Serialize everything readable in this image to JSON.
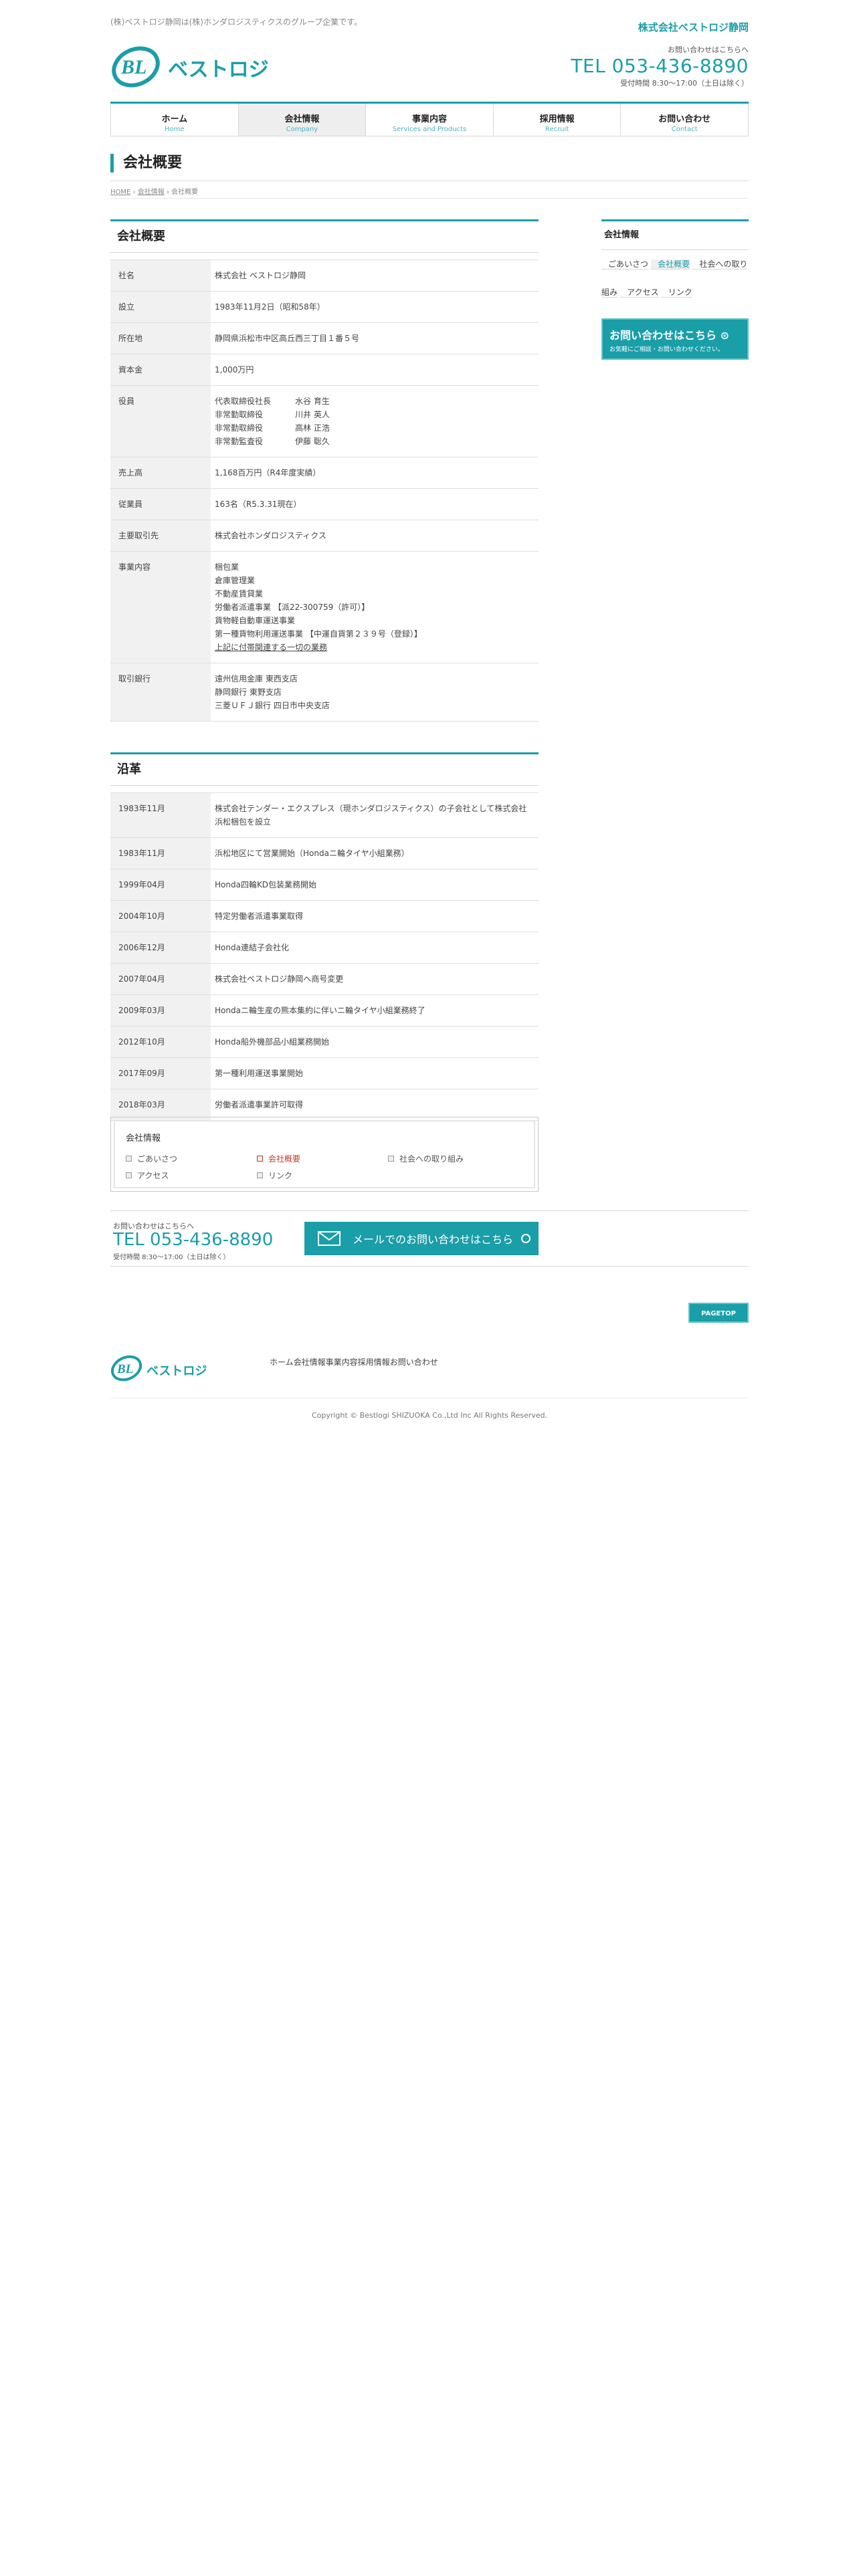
{
  "header": {
    "tagline": "(株)ベストロジ静岡は(株)ホンダロジスティクスのグループ企業です。",
    "corp_name": "株式会社ベストロジ静岡",
    "logo_text": "ベストロジ",
    "contact_label": "お問い合わせはこちらへ",
    "tel": "TEL 053-436-8890",
    "hours": "受付時間 8:30〜17:00（土日は除く）"
  },
  "gnav": [
    {
      "ja": "ホーム",
      "en": "Home"
    },
    {
      "ja": "会社情報",
      "en": "Company"
    },
    {
      "ja": "事業内容",
      "en": "Services and Products"
    },
    {
      "ja": "採用情報",
      "en": "Recruit"
    },
    {
      "ja": "お問い合わせ",
      "en": "Contact"
    }
  ],
  "page_title": "会社概要",
  "breadcrumb": {
    "home": "HOME",
    "company": "会社情報",
    "current": "会社概要",
    "sep": "›"
  },
  "overview": {
    "heading": "会社概要",
    "rows": [
      {
        "th": "社名",
        "td": [
          "株式会社 ベストロジ静岡"
        ]
      },
      {
        "th": "設立",
        "td": [
          "1983年11月2日（昭和58年）"
        ]
      },
      {
        "th": "所在地",
        "td": [
          "静岡県浜松市中区高丘西三丁目１番５号"
        ]
      },
      {
        "th": "資本金",
        "td": [
          "1,000万円"
        ]
      },
      {
        "th": "売上高",
        "td": [
          "1,168百万円（R4年度実績）"
        ]
      },
      {
        "th": "従業員",
        "td": [
          "163名（R5.3.31現在）"
        ]
      },
      {
        "th": "主要取引先",
        "td": [
          "株式会社ホンダロジスティクス"
        ]
      },
      {
        "th": "事業内容",
        "td": [
          "梱包業",
          "倉庫管理業",
          "不動産賃貸業",
          "労働者派遣事業 【派22-300759（許可）】",
          "貨物軽自動車運送事業",
          "第一種貨物利用運送事業 【中運自貨第２３９号（登録）】",
          "上記に付帯関連する一切の業務"
        ]
      },
      {
        "th": "取引銀行",
        "td": [
          "遠州信用金庫 東西支店",
          "静岡銀行 東野支店",
          "三菱ＵＦＪ銀行 四日市中央支店"
        ]
      }
    ],
    "officers_th": "役員",
    "officers": [
      {
        "role": "代表取締役社長",
        "name": "水谷 育生"
      },
      {
        "role": "非常勤取締役",
        "name": "川井 英人"
      },
      {
        "role": "非常勤取締役",
        "name": "高林 正浩"
      },
      {
        "role": "非常勤監査役",
        "name": "伊藤 聡久"
      }
    ]
  },
  "history": {
    "heading": "沿革",
    "rows": [
      {
        "th": "1983年11月",
        "td": "株式会社テンダー・エクスプレス（現ホンダロジスティクス）の子会社として株式会社浜松梱包を設立"
      },
      {
        "th": "1983年11月",
        "td": "浜松地区にて営業開始（Hondaニ輪タイヤ小組業務）"
      },
      {
        "th": "1999年04月",
        "td": "Honda四輪KD包装業務開始"
      },
      {
        "th": "2004年10月",
        "td": "特定労働者派遣事業取得"
      },
      {
        "th": "2006年12月",
        "td": "Honda連結子会社化"
      },
      {
        "th": "2007年04月",
        "td": "株式会社ベストロジ静岡へ商号変更"
      },
      {
        "th": "2009年03月",
        "td": "Hondaニ輪生産の熊本集約に伴いニ輪タイヤ小組業務終了"
      },
      {
        "th": "2012年10月",
        "td": "Honda船外機部品小組業務開始"
      },
      {
        "th": "2017年09月",
        "td": "第一種利用運送事業開始"
      },
      {
        "th": "2018年03月",
        "td": "労働者派遣事業許可取得"
      }
    ]
  },
  "side": {
    "heading": "会社情報",
    "items": [
      "ごあいさつ",
      "会社概要",
      "社会への取り組み",
      "アクセス",
      "リンク"
    ],
    "active_index": 1,
    "banner_main": "お問い合わせはこちら",
    "banner_sub": "お気軽にご相談・お問い合わせください。"
  },
  "subnav": {
    "title": "会社情報",
    "items": [
      "ごあいさつ",
      "会社概要",
      "社会への取り組み",
      "アクセス",
      "リンク"
    ]
  },
  "footer_contact": {
    "label": "お問い合わせはこちらへ",
    "tel": "TEL 053-436-8890",
    "hours": "受付時間 8:30〜17:00（土日は除く）",
    "mail_button": "メールでのお問い合わせはこちら"
  },
  "pagetop": "PAGETOP",
  "footer_nav": [
    "ホーム",
    "会社情報",
    "事業内容",
    "採用情報",
    "お問い合わせ"
  ],
  "copyright": "Copyright © Bestlogi SHIZUOKA Co.,Ltd Inc All Rights Reserved.",
  "colors": {
    "accent": "#1a9ea8",
    "active_link": "#c0392b"
  }
}
